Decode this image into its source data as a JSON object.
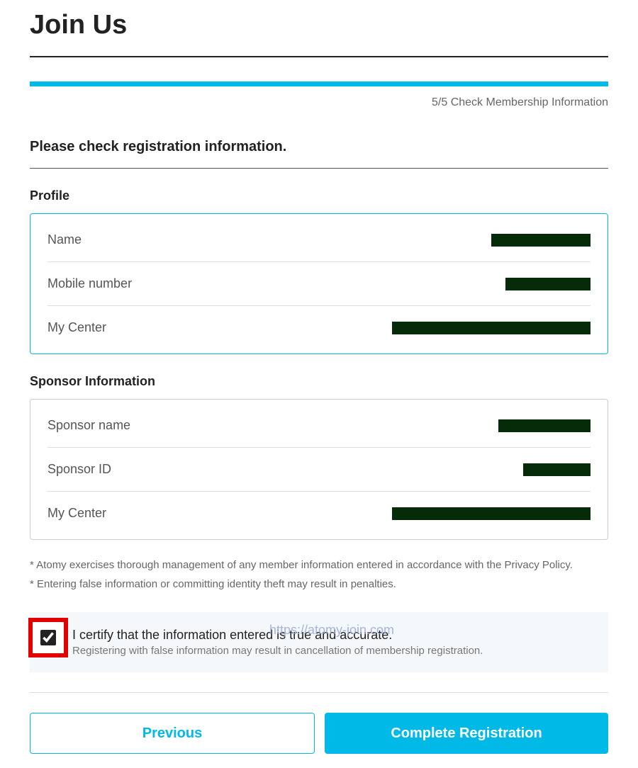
{
  "page_title": "Join Us",
  "step_label": "5/5 Check Membership Information",
  "check_info_label": "Please check registration information.",
  "profile": {
    "title": "Profile",
    "rows": [
      {
        "label": "Name",
        "redacted_width": 140
      },
      {
        "label": "Mobile number",
        "redacted_width": 120
      },
      {
        "label": "My Center",
        "redacted_width": 280
      }
    ]
  },
  "sponsor": {
    "title": "Sponsor Information",
    "rows": [
      {
        "label": "Sponsor name",
        "redacted_width": 130
      },
      {
        "label": "Sponsor ID",
        "redacted_width": 95
      },
      {
        "label": "My Center",
        "redacted_width": 280
      }
    ]
  },
  "footnotes": [
    "* Atomy exercises thorough management of any member information entered in accordance with the Privacy Policy.",
    "* Entering false information or committing identity theft may result in penalties."
  ],
  "certify": {
    "main": "I certify that the information entered is true and accurate.",
    "sub": "Registering with false information may result in cancellation of membership registration.",
    "checked": true
  },
  "watermark": "https://atomy-join.com",
  "buttons": {
    "previous": "Previous",
    "complete": "Complete Registration"
  }
}
